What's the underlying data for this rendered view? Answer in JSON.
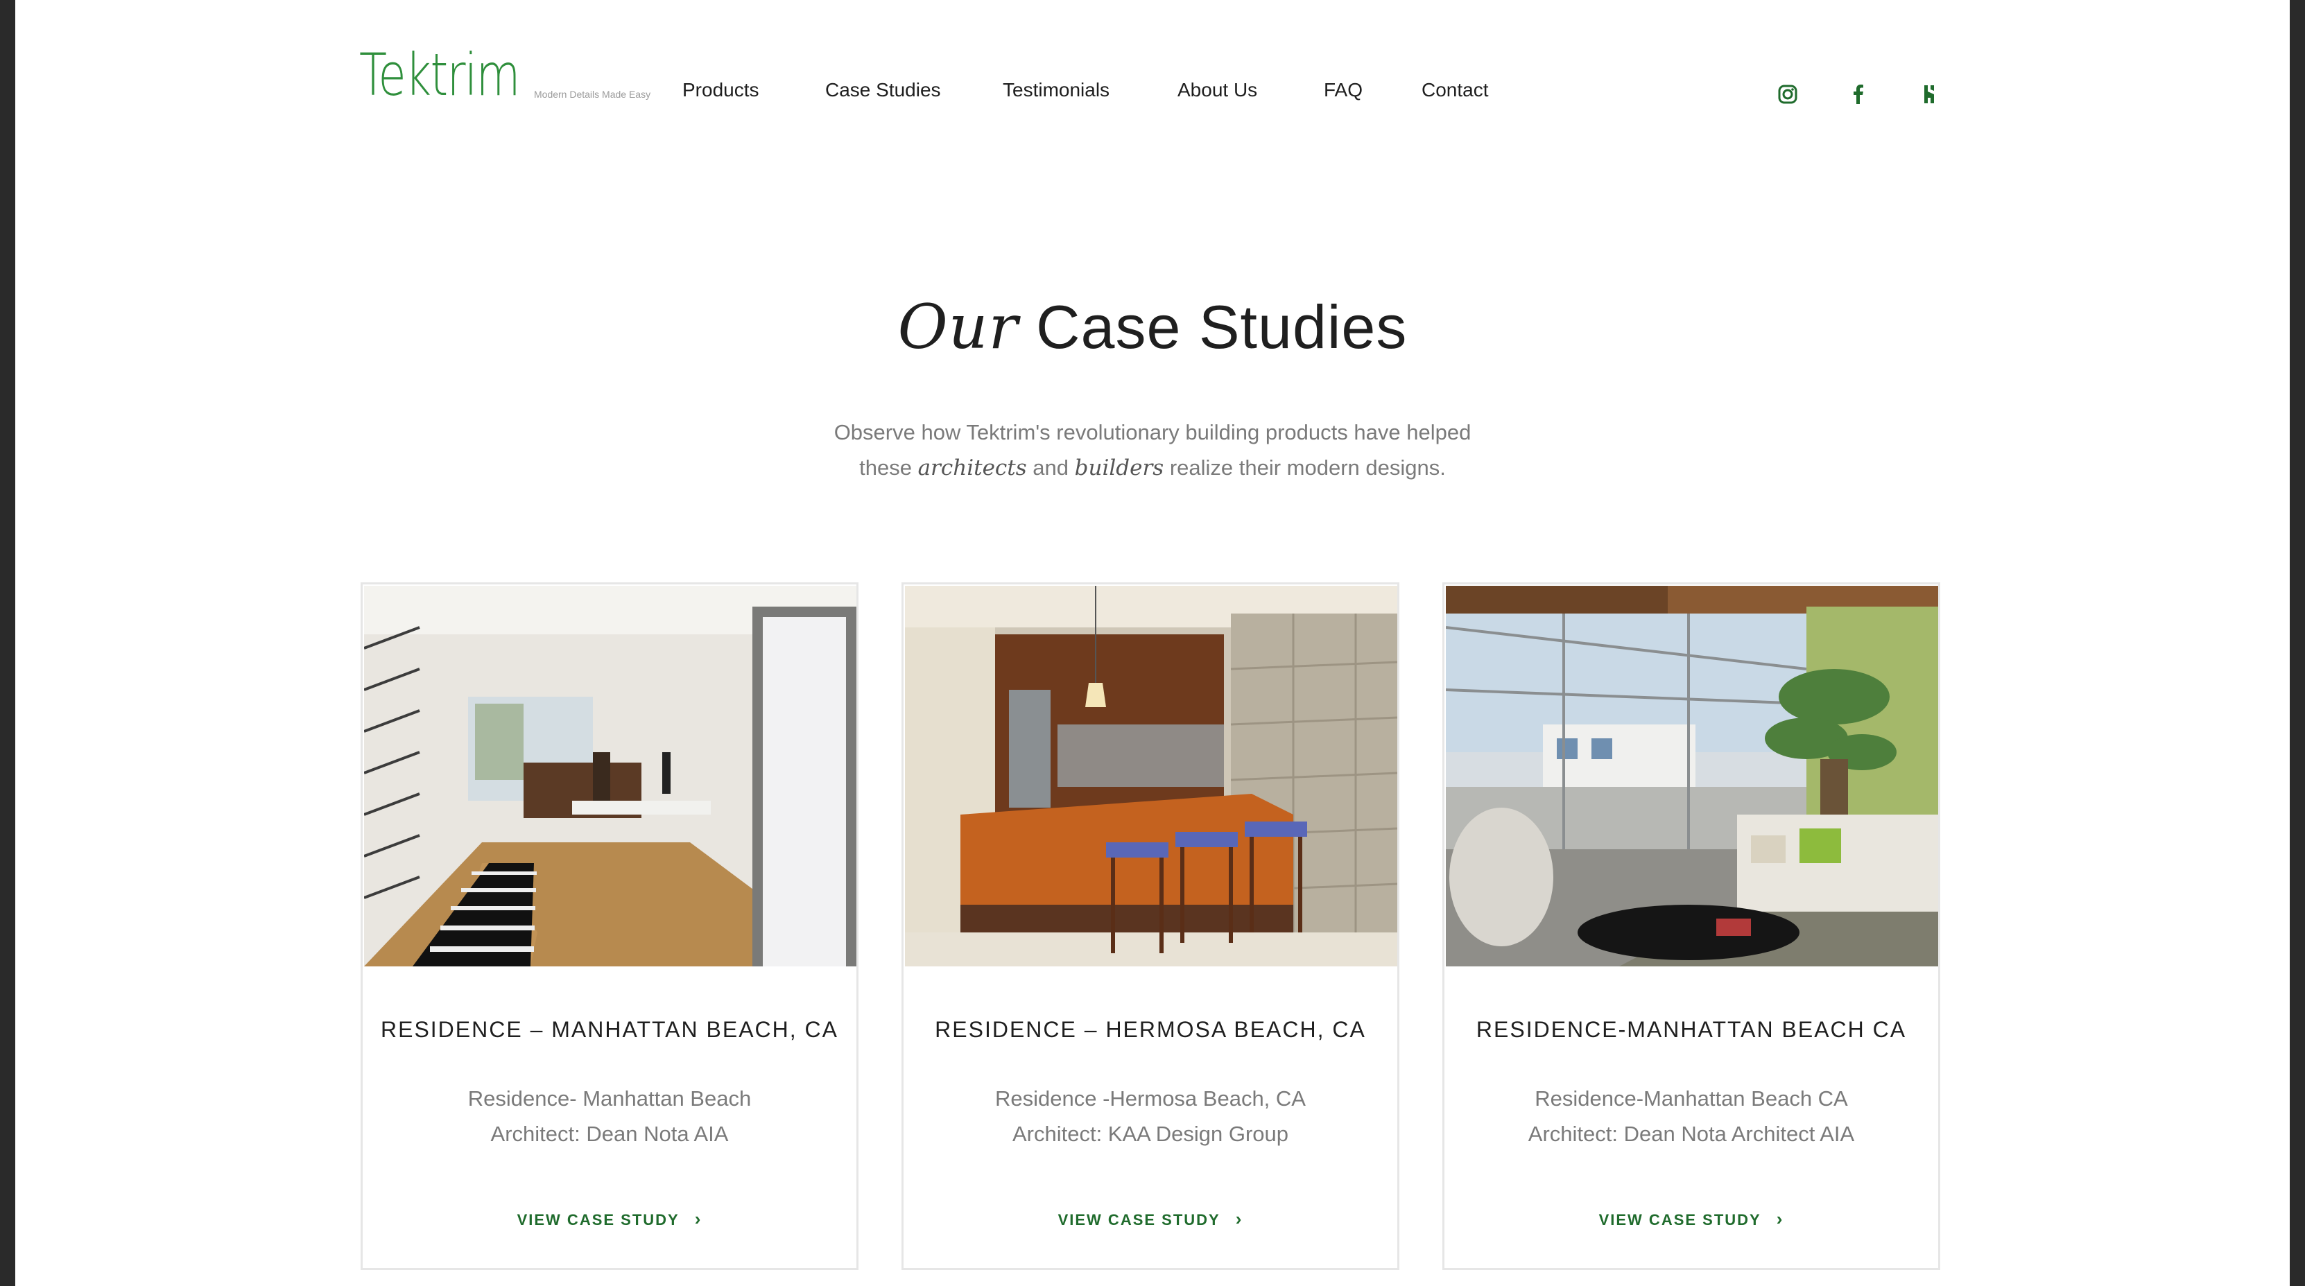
{
  "brand": {
    "name": "Tektrim",
    "tagline": "Modern Details Made Easy",
    "accent": "#2f8f3c",
    "cta_color": "#1f6b2c"
  },
  "nav": {
    "items": [
      {
        "label": "Products"
      },
      {
        "label": "Case Studies"
      },
      {
        "label": "Testimonials"
      },
      {
        "label": "About Us"
      },
      {
        "label": "FAQ"
      },
      {
        "label": "Contact"
      }
    ]
  },
  "social": [
    {
      "icon": "instagram-icon"
    },
    {
      "icon": "facebook-icon"
    },
    {
      "icon": "houzz-icon"
    }
  ],
  "hero": {
    "heading_em": "Our",
    "heading_rest": "Case Studies",
    "subtitle_line1": "Observe how Tektrim's revolutionary building products have helped",
    "subtitle_pre": "these",
    "subtitle_it1": "architects",
    "subtitle_mid": "and",
    "subtitle_it2": "builders",
    "subtitle_post": "realize their modern designs."
  },
  "cards": [
    {
      "title": "RESIDENCE – MANHATTAN BEACH, CA",
      "line1": "Residence- Manhattan Beach",
      "line2": "Architect: Dean Nota AIA",
      "cta": "VIEW CASE STUDY",
      "image": "interior-hallway-dining-photo"
    },
    {
      "title": "RESIDENCE – HERMOSA BEACH, CA",
      "line1": "Residence -Hermosa Beach, CA",
      "line2": "Architect: KAA Design Group",
      "cta": "VIEW CASE STUDY",
      "image": "kitchen-bar-photo"
    },
    {
      "title": "RESIDENCE-MANHATTAN BEACH CA",
      "line1": "Residence-Manhattan Beach CA",
      "line2": "Architect: Dean Nota Architect AIA",
      "cta": "VIEW CASE STUDY",
      "image": "living-room-balcony-photo"
    }
  ]
}
